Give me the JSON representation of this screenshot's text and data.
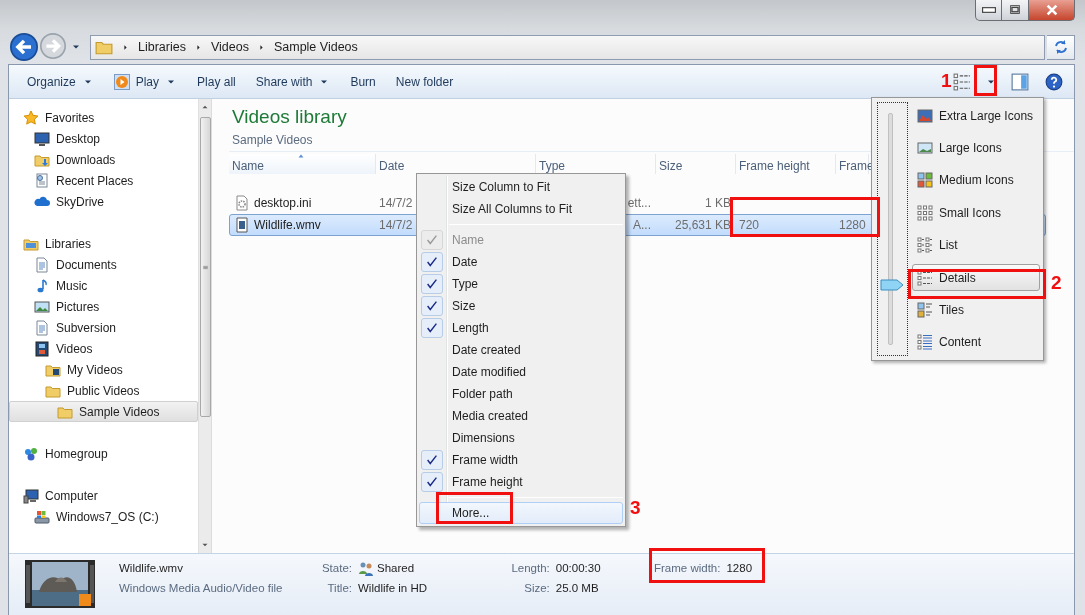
{
  "window_controls": [
    {
      "kind": "minimize"
    },
    {
      "kind": "maximize"
    },
    {
      "kind": "close"
    }
  ],
  "address_bar": {
    "breadcrumbs": [
      "Libraries",
      "Videos",
      "Sample Videos"
    ]
  },
  "toolbar": {
    "buttons": [
      {
        "label": "Organize",
        "kind": "menu"
      },
      {
        "label": "Play",
        "kind": "play"
      },
      {
        "label": "Play all",
        "kind": "plain"
      },
      {
        "label": "Share with",
        "kind": "menu"
      },
      {
        "label": "Burn",
        "kind": "plain"
      },
      {
        "label": "New folder",
        "kind": "plain"
      }
    ],
    "tools": [
      {
        "kind": "view"
      },
      {
        "kind": "view-menu"
      },
      {
        "kind": "preview-pane"
      },
      {
        "kind": "help"
      }
    ]
  },
  "sidebar": {
    "groups": [
      {
        "label": "Favorites",
        "kind": "star",
        "selected": false,
        "children": [
          {
            "label": "Desktop",
            "kind": "desktop",
            "selected": false
          },
          {
            "label": "Downloads",
            "kind": "download-folder",
            "selected": false
          },
          {
            "label": "Recent Places",
            "kind": "recent",
            "selected": false
          },
          {
            "label": "SkyDrive",
            "kind": "cloud",
            "selected": false
          }
        ]
      },
      {
        "label": "Libraries",
        "kind": "library",
        "selected": false,
        "children": [
          {
            "label": "Documents",
            "kind": "document",
            "selected": false
          },
          {
            "label": "Music",
            "kind": "music",
            "selected": false
          },
          {
            "label": "Pictures",
            "kind": "picture",
            "selected": false
          },
          {
            "label": "Subversion",
            "kind": "document",
            "selected": false
          },
          {
            "label": "Videos",
            "kind": "film",
            "selected": false,
            "children": [
              {
                "label": "My Videos",
                "kind": "video-folder",
                "selected": false
              },
              {
                "label": "Public Videos",
                "kind": "folder",
                "selected": false,
                "children": [
                  {
                    "label": "Sample Videos",
                    "kind": "folder",
                    "selected": true
                  }
                ]
              }
            ]
          }
        ]
      },
      {
        "label": "Homegroup",
        "kind": "homegroup",
        "selected": false
      },
      {
        "label": "Computer",
        "kind": "computer",
        "selected": false,
        "children": [
          {
            "label": "Windows7_OS (C:)",
            "kind": "drive",
            "selected": false
          }
        ]
      }
    ]
  },
  "library": {
    "title": "Videos library",
    "subtitle": "Sample Videos"
  },
  "table": {
    "columns": [
      {
        "label": "Name",
        "sorted": true
      },
      {
        "label": "Date",
        "sorted": false
      },
      {
        "label": "Type",
        "sorted": false
      },
      {
        "label": "Size",
        "sorted": false
      },
      {
        "label": "Frame height",
        "sorted": false
      },
      {
        "label": "Frame",
        "sorted": false
      }
    ],
    "rows": [
      {
        "kind": "settings-file",
        "selected": false,
        "cells": [
          "desktop.ini",
          "14/7/2",
          "ett...",
          "1 KB"
        ]
      },
      {
        "kind": "video-file",
        "selected": true,
        "cells": [
          "Wildlife.wmv",
          "14/7/2",
          "A...",
          "25,631 KB",
          "720",
          "1280"
        ]
      }
    ]
  },
  "column_menu": {
    "items": [
      {
        "kind": "command",
        "label": "Size Column to Fit",
        "highlighted": false
      },
      {
        "kind": "command",
        "label": "Size All Columns to Fit",
        "highlighted": false
      },
      {
        "kind": "separator"
      },
      {
        "kind": "option",
        "label": "Name",
        "checked": true,
        "disabled": true
      },
      {
        "kind": "option",
        "label": "Date",
        "checked": true,
        "disabled": false
      },
      {
        "kind": "option",
        "label": "Type",
        "checked": true,
        "disabled": false
      },
      {
        "kind": "option",
        "label": "Size",
        "checked": true,
        "disabled": false
      },
      {
        "kind": "option",
        "label": "Length",
        "checked": true,
        "disabled": false
      },
      {
        "kind": "option",
        "label": "Date created",
        "checked": false,
        "disabled": false
      },
      {
        "kind": "option",
        "label": "Date modified",
        "checked": false,
        "disabled": false
      },
      {
        "kind": "option",
        "label": "Folder path",
        "checked": false,
        "disabled": false
      },
      {
        "kind": "option",
        "label": "Media created",
        "checked": false,
        "disabled": false
      },
      {
        "kind": "option",
        "label": "Dimensions",
        "checked": false,
        "disabled": false
      },
      {
        "kind": "option",
        "label": "Frame width",
        "checked": true,
        "disabled": false
      },
      {
        "kind": "option",
        "label": "Frame height",
        "checked": true,
        "disabled": false
      },
      {
        "kind": "separator"
      },
      {
        "kind": "command",
        "label": "More...",
        "highlighted": true
      }
    ]
  },
  "view_menu": {
    "level": 0.26,
    "items": [
      {
        "label": "Extra Large Icons",
        "kind": "extra-large",
        "selected": false
      },
      {
        "label": "Large Icons",
        "kind": "large",
        "selected": false
      },
      {
        "label": "Medium Icons",
        "kind": "medium",
        "selected": false
      },
      {
        "label": "Small Icons",
        "kind": "small",
        "selected": false
      },
      {
        "label": "List",
        "kind": "list",
        "selected": false
      },
      {
        "label": "Details",
        "kind": "details",
        "selected": true
      },
      {
        "label": "Tiles",
        "kind": "tiles",
        "selected": false
      },
      {
        "label": "Content",
        "kind": "content",
        "selected": false
      }
    ]
  },
  "details_pane": {
    "file_name": "Wildlife.wmv",
    "file_type": "Windows Media Audio/Video file",
    "property_columns": [
      [
        {
          "label": "State:",
          "value": "Shared",
          "kind": "shared"
        },
        {
          "label": "Title:",
          "value": "Wildlife in HD",
          "kind": "plain"
        }
      ],
      [
        {
          "label": "Length:",
          "value": "00:00:30",
          "kind": "plain"
        },
        {
          "label": "Size:",
          "value": "25.0 MB",
          "kind": "plain"
        }
      ],
      [
        {
          "label": "Frame width:",
          "value": "1280",
          "kind": "plain"
        }
      ]
    ]
  },
  "annotations": [
    {
      "kind": "box"
    },
    {
      "kind": "box",
      "label": "1"
    },
    {
      "kind": "box",
      "label": "2"
    },
    {
      "kind": "box",
      "label": "3"
    },
    {
      "kind": "box"
    }
  ]
}
